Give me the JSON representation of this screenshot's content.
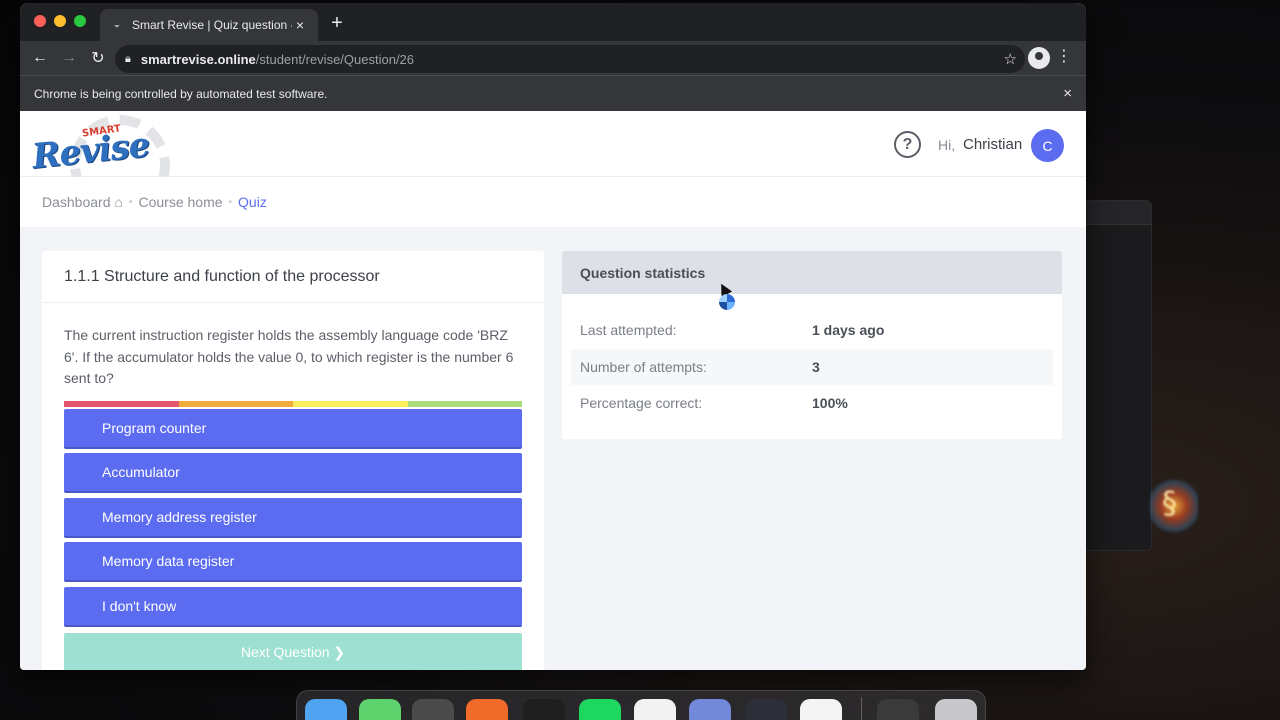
{
  "browser": {
    "tab_title": "Smart Revise | Quiz question -",
    "tab_close": "×",
    "new_tab": "+",
    "url_host": "smartrevise.online",
    "url_path": "/student/revise/Question/26",
    "infobar_text": "Chrome is being controlled by automated test software.",
    "infobar_close": "×"
  },
  "site": {
    "logo_small": "SMART",
    "logo_main": "Revise",
    "help": "?",
    "greeting": "Hi,",
    "user_name": "Christian",
    "avatar_initial": "C"
  },
  "breadcrumb": {
    "dashboard": "Dashboard",
    "course_home": "Course home",
    "quiz": "Quiz",
    "separator": "•"
  },
  "quiz": {
    "topic": "1.1.1 Structure and function of the processor",
    "question": "The current instruction register holds the assembly language code 'BRZ 6'. If the accumulator holds the value 0, to which register is the number 6 sent to?",
    "confidence_colors": [
      "#e4566e",
      "#f0ad3e",
      "#fbee5e",
      "#a9dc78"
    ],
    "answers": [
      "Program counter",
      "Accumulator",
      "Memory address register",
      "Memory data register",
      "I don't know"
    ],
    "next_button": "Next Question ❯"
  },
  "stats": {
    "title": "Question statistics",
    "rows": [
      {
        "label": "Last attempted:",
        "value": "1 days ago"
      },
      {
        "label": "Number of attempts:",
        "value": "3"
      },
      {
        "label": "Percentage correct:",
        "value": "100%"
      }
    ]
  },
  "colors": {
    "primary": "#5b6cf0",
    "next_disabled": "#9ee0d1",
    "stats_header": "#dde0e7"
  },
  "dock": {
    "apps": [
      {
        "name": "finder-icon",
        "color": "#4fa3f0"
      },
      {
        "name": "messages-icon",
        "color": "#5cd16c"
      },
      {
        "name": "sublime-icon",
        "color": "#4a4a4a"
      },
      {
        "name": "firefox-icon",
        "color": "#f06a2a"
      },
      {
        "name": "terminal-icon",
        "color": "#1e1e1e"
      },
      {
        "name": "spotify-icon",
        "color": "#1ed760"
      },
      {
        "name": "whatsapp-icon",
        "color": "#f2f2f2"
      },
      {
        "name": "discord-icon",
        "color": "#7289da"
      },
      {
        "name": "obs-icon",
        "color": "#2c2e38"
      },
      {
        "name": "chrome-icon",
        "color": "#f4f4f4"
      },
      {
        "name": "screenshot-icon",
        "color": "#3a3a3a"
      },
      {
        "name": "trash-icon",
        "color": "#c8c8cc"
      }
    ]
  }
}
